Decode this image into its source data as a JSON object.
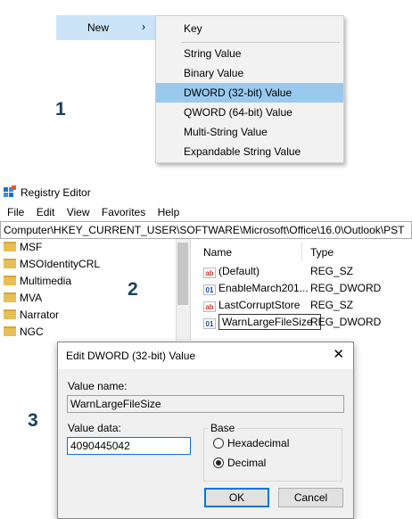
{
  "context_menu": {
    "new_label": "New",
    "new_arrow": "›",
    "submenu": [
      "Key",
      "String Value",
      "Binary Value",
      "DWORD (32-bit) Value",
      "QWORD (64-bit) Value",
      "Multi-String Value",
      "Expandable String Value"
    ],
    "highlighted": "DWORD (32-bit) Value"
  },
  "steps": [
    "1",
    "2",
    "3"
  ],
  "registry_editor": {
    "title": "Registry Editor",
    "menu": [
      "File",
      "Edit",
      "View",
      "Favorites",
      "Help"
    ],
    "address": "Computer\\HKEY_CURRENT_USER\\SOFTWARE\\Microsoft\\Office\\16.0\\Outlook\\PST",
    "tree": [
      "MSF",
      "MSOIdentityCRL",
      "Multimedia",
      "MVA",
      "Narrator",
      "NGC"
    ],
    "columns": {
      "name": "Name",
      "type": "Type"
    },
    "values": [
      {
        "name": "(Default)",
        "type": "REG_SZ",
        "icon": "ab"
      },
      {
        "name": "EnableMarch201...",
        "type": "REG_DWORD",
        "icon": "bin"
      },
      {
        "name": "LastCorruptStore",
        "type": "REG_SZ",
        "icon": "ab"
      },
      {
        "name": "WarnLargeFileSize",
        "type": "REG_DWORD",
        "icon": "bin"
      }
    ]
  },
  "dialog": {
    "title": "Edit DWORD (32-bit) Value",
    "close": "✕",
    "value_name_label": "Value name:",
    "value_name": "WarnLargeFileSize",
    "value_data_label": "Value data:",
    "value_data": "4090445042",
    "base_label": "Base",
    "hex_label": "Hexadecimal",
    "dec_label": "Decimal",
    "selected_base": "Decimal",
    "ok": "OK",
    "cancel": "Cancel"
  }
}
